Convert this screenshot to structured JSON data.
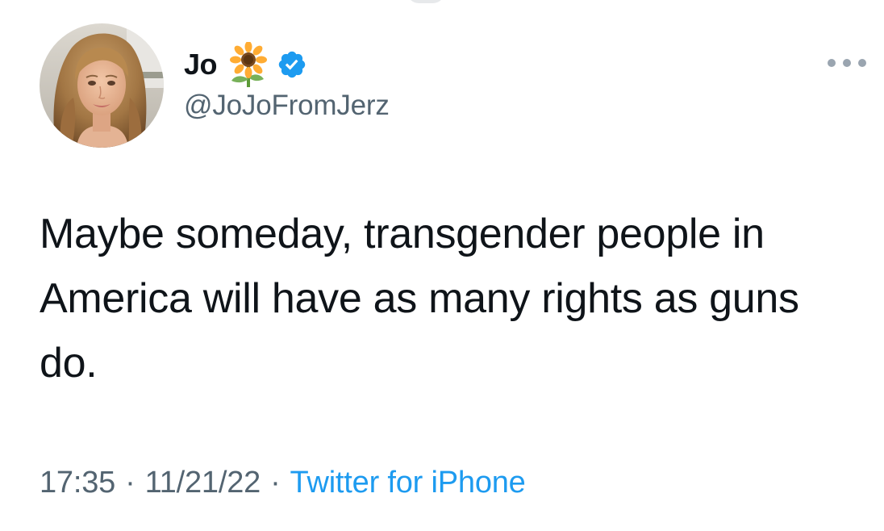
{
  "tweet": {
    "author": {
      "display_name": "Jo",
      "name_emoji": "sunflower",
      "verified": true,
      "handle": "@JoJoFromJerz"
    },
    "text": "Maybe someday, transgender people in America will have as many rights as guns do.",
    "time": "17:35",
    "separator": "·",
    "date": "11/21/22",
    "source": "Twitter for iPhone"
  },
  "icons": {
    "more": "more-horizontal-icon",
    "verified": "verified-badge-icon",
    "emoji": "sunflower-icon"
  },
  "colors": {
    "text_primary": "#0f1419",
    "text_secondary": "#536471",
    "link": "#1d9bf0",
    "verified": "#1d9bf0"
  }
}
